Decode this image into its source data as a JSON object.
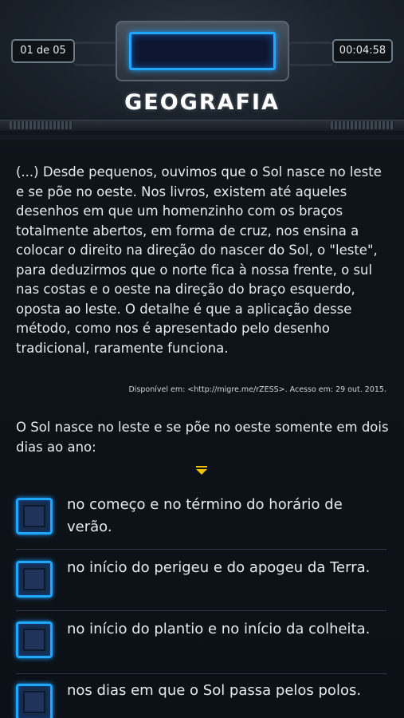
{
  "header": {
    "counter": "01 de 05",
    "timer": "00:04:58",
    "subject": "GEOGRAFIA"
  },
  "passage": {
    "text": "(...) Desde pequenos, ouvimos que o Sol nasce no leste e se põe no oeste. Nos livros, existem até aqueles desenhos em que um homenzinho com os braços totalmente abertos, em forma de cruz, nos ensina a colocar o direito na direção do nascer do Sol, o \"leste\", para deduzirmos que o norte fica à nossa frente, o sul nas costas e o oeste na direção do braço esquerdo, oposta ao leste. O detalhe é que a aplicação desse método, como nos é apresentado pelo desenho tradicional, raramente funciona.",
    "source": "Disponível em: <http://migre.me/rZESS>. Acesso em: 29 out. 2015."
  },
  "question": "O Sol nasce no leste e se põe no oeste somente em dois dias ao ano:",
  "options": [
    {
      "label": "no começo e no término do horário de verão."
    },
    {
      "label": "no início do perigeu e do apogeu da Terra."
    },
    {
      "label": "no início do plantio e no início da colheita."
    },
    {
      "label": "nos dias em que o Sol passa pelos polos."
    }
  ],
  "colors": {
    "accent": "#1ea8ff",
    "arrow": "#f2c200",
    "background": "#0c1117"
  }
}
